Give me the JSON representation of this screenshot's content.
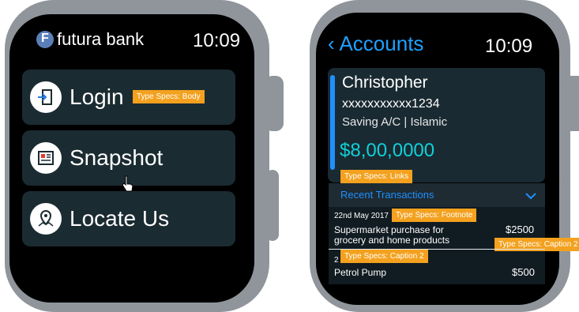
{
  "left": {
    "brand": "futura bank",
    "time": "10:09",
    "menu": [
      {
        "label": "Login"
      },
      {
        "label": "Snapshot"
      },
      {
        "label": "Locate Us"
      }
    ],
    "annotation_body": "Type Specs: Body"
  },
  "right": {
    "back_label": "Accounts",
    "time": "10:09",
    "account": {
      "name": "Christopher",
      "number": "xxxxxxxxxxx1234",
      "type": "Saving A/C | Islamic",
      "balance": "$8,00,0000"
    },
    "annotation_links": "Type Specs: Links",
    "recent_label": "Recent Transactions",
    "transactions": [
      {
        "date": "22nd May 2017",
        "desc_line1": "Supermarket purchase for",
        "desc_line2": "grocery and home products",
        "amount": "$2500"
      },
      {
        "date": "2",
        "desc_line1": "Petrol Pump",
        "amount": "$500"
      }
    ],
    "annotation_footnote": "Type Specs: Footnote",
    "annotation_caption2": "Type Specs: Caption 2",
    "annotation_caption2_right": "Type Specs: Caption 2"
  },
  "colors": {
    "accent": "#1ea1ff",
    "balance": "#11d0d8",
    "tag": "#f3a11e",
    "card": "#1b2b32"
  }
}
